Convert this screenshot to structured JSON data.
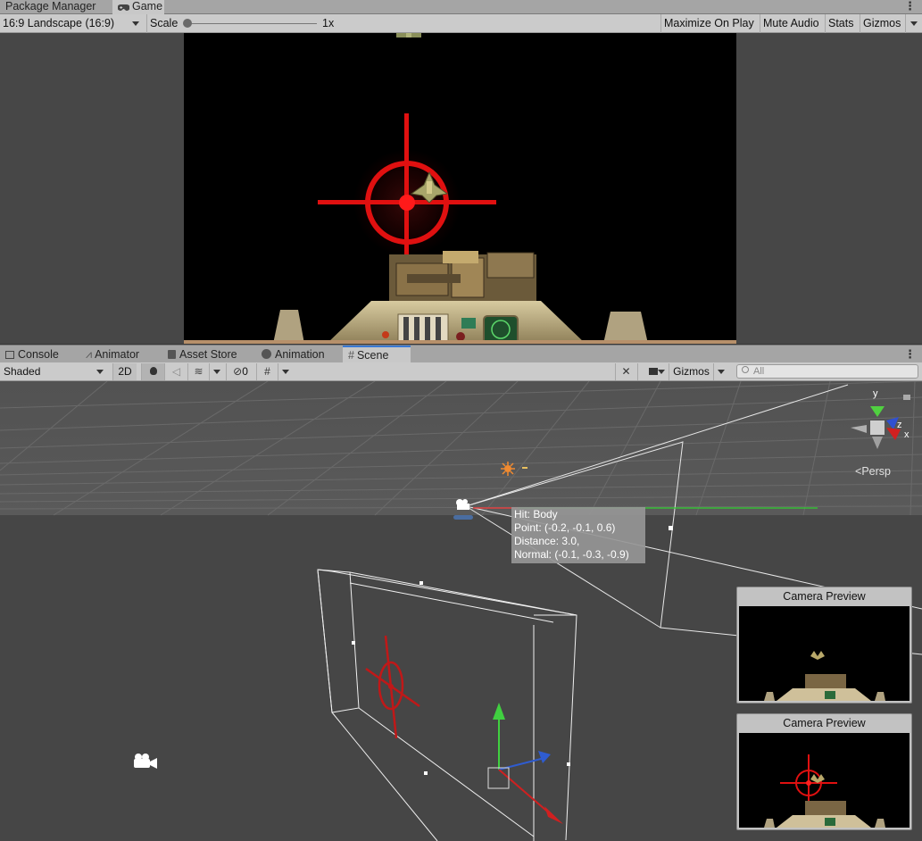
{
  "game_panel": {
    "tabs": [
      {
        "label": "Package Manager",
        "active": false
      },
      {
        "label": "Game",
        "active": true,
        "icon": "gamepad-icon"
      }
    ],
    "toolbar": {
      "aspect": "16:9 Landscape (16:9)",
      "scale_label": "Scale",
      "scale_value": "1x",
      "maximize_on_play": "Maximize On Play",
      "mute_audio": "Mute Audio",
      "stats": "Stats",
      "gizmos": "Gizmos"
    }
  },
  "scene_panel": {
    "tabs": [
      {
        "label": "Console",
        "icon": "console-icon",
        "active": false
      },
      {
        "label": "Animator",
        "icon": "animator-icon",
        "active": false
      },
      {
        "label": "Asset Store",
        "icon": "store-icon",
        "active": false
      },
      {
        "label": "Animation",
        "icon": "clock-icon",
        "active": false
      },
      {
        "label": "Scene",
        "icon": "grid-icon",
        "active": true
      }
    ],
    "toolbar": {
      "draw_mode": "Shaded",
      "toggle_2d": "2D",
      "hidden_count": "0",
      "gizmos": "Gizmos",
      "search_placeholder": "All"
    },
    "persp_label": "Persp",
    "hit_tooltip": {
      "line1": "Hit: Body",
      "line2": "Point: (-0.2, -0.1, 0.6)",
      "line3": "Distance: 3.0,",
      "line4": "Normal: (-0.1, -0.3, -0.9)"
    },
    "camera_previews": [
      {
        "title": "Camera Preview"
      },
      {
        "title": "Camera Preview"
      }
    ],
    "axis_labels": {
      "y": "y",
      "z": "z",
      "x": "x"
    }
  },
  "colors": {
    "crosshair": "#e01010",
    "scene_bg": "#464646",
    "accent_tab": "#3a79d4"
  }
}
